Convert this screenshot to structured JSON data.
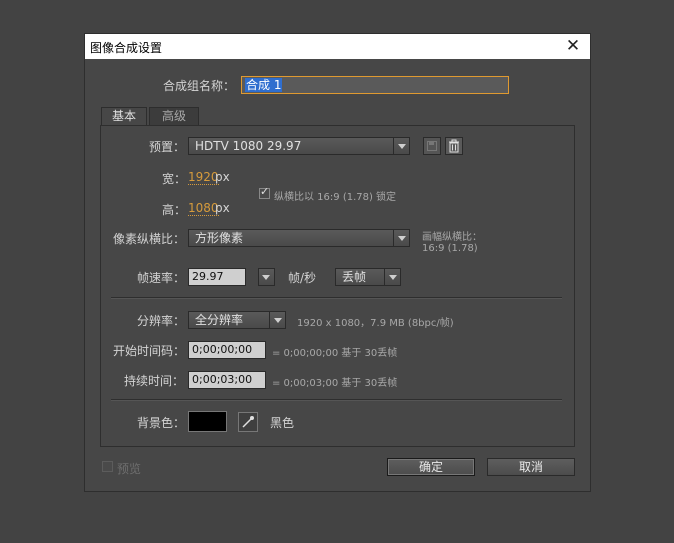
{
  "dialog": {
    "title": "图像合成设置",
    "close_glyph": "✕"
  },
  "name": {
    "label": "合成组名称：",
    "value": "合成 1"
  },
  "tabs": [
    {
      "label": "基本"
    },
    {
      "label": "高级"
    }
  ],
  "preset": {
    "label": "预置：",
    "value": "HDTV 1080 29.97"
  },
  "width": {
    "label": "宽：",
    "value": "1920",
    "unit": "px"
  },
  "height": {
    "label": "高：",
    "value": "1080",
    "unit": "px"
  },
  "lock_aspect": {
    "checked": true,
    "check_glyph": "✓",
    "label": "纵横比以 16:9 (1.78) 锁定"
  },
  "pixel_aspect": {
    "label": "像素纵横比：",
    "value": "方形像素",
    "frame_aspect_label": "画幅纵横比：",
    "frame_aspect_value": "16:9 (1.78)"
  },
  "frame_rate": {
    "label": "帧速率：",
    "value": "29.97",
    "unit": "帧/秒",
    "drop_value": "丢帧"
  },
  "resolution": {
    "label": "分辨率：",
    "value": "全分辨率",
    "info": "1920 x 1080，7.9 MB (8bpc/帧)"
  },
  "start_timecode": {
    "label": "开始时间码：",
    "value": "0;00;00;00",
    "info": "= 0;00;00;00  基于 30丢帧"
  },
  "duration": {
    "label": "持续时间：",
    "value": "0;00;03;00",
    "info": "= 0;00;03;00  基于 30丢帧"
  },
  "background": {
    "label": "背景色：",
    "color": "#000000",
    "color_name": "黑色"
  },
  "preview": {
    "label": "预览",
    "checked": false
  },
  "buttons": {
    "ok": "确定",
    "cancel": "取消"
  },
  "icons": {
    "save_preset": "save-icon",
    "delete_preset": "trash-icon",
    "eyedropper": "eyedropper-icon"
  }
}
